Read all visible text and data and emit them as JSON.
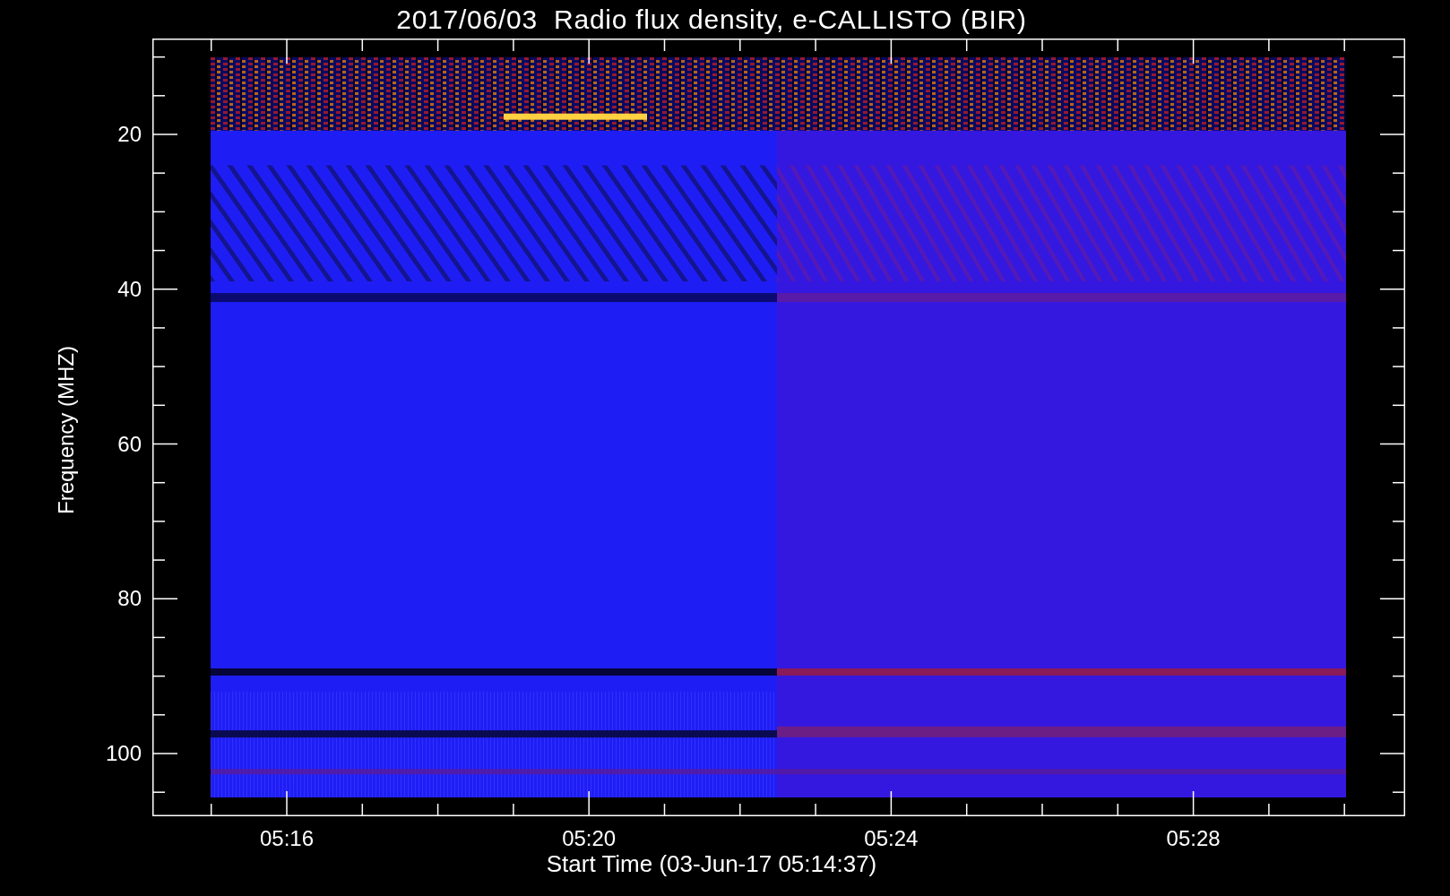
{
  "plot": {
    "title": "2017/06/03  Radio flux density, e-CALLISTO (BIR)",
    "ylabel": "Frequency (MHZ)",
    "xlabel": "Start Time (03-Jun-17 05:14:37)",
    "y_tick_labels": [
      "20",
      "40",
      "60",
      "80",
      "100"
    ],
    "x_tick_labels": [
      "05:16",
      "05:20",
      "05:24",
      "05:28"
    ]
  }
}
